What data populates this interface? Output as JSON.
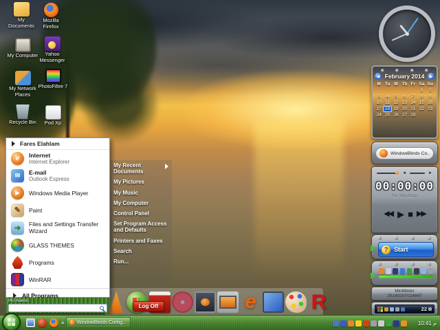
{
  "desktop": {
    "icons": [
      {
        "label": "My Documents",
        "icon": "folder-documents-icon"
      },
      {
        "label": "Mozilla Firefox",
        "icon": "firefox-icon"
      },
      {
        "label": "My Computer",
        "icon": "computer-icon"
      },
      {
        "label": "Yahoo Messenger",
        "icon": "yahoo-icon"
      },
      {
        "label": "My Network Places",
        "icon": "network-icon"
      },
      {
        "label": "PhotoFiltre 7",
        "icon": "photofiltre-icon"
      },
      {
        "label": "Recycle Bin",
        "icon": "recycle-icon"
      },
      {
        "label": "Pod Xp",
        "icon": "podxp-icon"
      }
    ]
  },
  "start_menu": {
    "user_name": "Fares Elahlam",
    "left_items": [
      {
        "title": "Internet",
        "subtitle": "Internet Explorer",
        "icon": "internet-explorer-icon",
        "glyph": "e"
      },
      {
        "title": "E-mail",
        "subtitle": "Outlook Express",
        "icon": "outlook-icon",
        "glyph": "✉"
      },
      {
        "title": "Windows Media Player",
        "subtitle": "",
        "icon": "wmp-icon",
        "glyph": "▶"
      },
      {
        "title": "Paint",
        "subtitle": "",
        "icon": "paint-icon",
        "glyph": "✎"
      },
      {
        "title": "Files and Settings Transfer Wizard",
        "subtitle": "",
        "icon": "transfer-icon",
        "glyph": "➔"
      },
      {
        "title": "GLASS THEMES",
        "subtitle": "",
        "icon": "glass-icon",
        "glyph": ""
      },
      {
        "title": "Programs",
        "subtitle": "",
        "icon": "programs-icon",
        "glyph": ""
      },
      {
        "title": "WinRAR",
        "subtitle": "",
        "icon": "winrar-icon",
        "glyph": ""
      }
    ],
    "all_programs_label": "All Programs",
    "footer_text": "HU Aueoc",
    "search_value": "",
    "right_items": [
      {
        "label": "My Recent Documents",
        "has_arrow": true
      },
      {
        "label": "My Pictures",
        "has_arrow": false
      },
      {
        "label": "My Music",
        "has_arrow": false
      },
      {
        "label": "My Computer",
        "has_arrow": false
      },
      {
        "label": "Control Panel",
        "has_arrow": false
      },
      {
        "label": "Set Program Access and Defaults",
        "has_arrow": false
      },
      {
        "label": "Printers and Faxes",
        "has_arrow": false
      },
      {
        "label": "Search",
        "has_arrow": false
      },
      {
        "label": "Run...",
        "has_arrow": false
      }
    ],
    "log_off_label": "Log Off"
  },
  "dock": {
    "icons": [
      {
        "name": "traffic-cone-icon"
      },
      {
        "name": "windows-orb-icon"
      },
      {
        "name": "red-box-icon"
      },
      {
        "name": "red-disc-icon"
      },
      {
        "name": "media-monitor-icon"
      },
      {
        "name": "display-monitor-icon"
      },
      {
        "name": "internet-explorer-icon",
        "glyph": "e"
      },
      {
        "name": "blue-screen-icon"
      },
      {
        "name": "paint-palette-icon"
      },
      {
        "name": "letter-r-icon",
        "glyph": "R"
      }
    ]
  },
  "taskbar": {
    "quick_launch": [
      {
        "name": "show-desktop-icon"
      },
      {
        "name": "red-app-icon"
      },
      {
        "name": "firefox-icon"
      }
    ],
    "overflow_chevron": "»",
    "window_button_label": "WindowBlinds Config...",
    "tray_icons": [
      {
        "name": "tray-computer-icon",
        "color": "#4a7ab8"
      },
      {
        "name": "tray-documents-icon",
        "color": "#3a5ad0"
      },
      {
        "name": "tray-windowblinds-icon",
        "color": "#e8862a"
      },
      {
        "name": "tray-yahoo-icon",
        "color": "#f8d020"
      },
      {
        "name": "tray-red-app-icon",
        "color": "#d84010"
      },
      {
        "name": "tray-monitor-icon",
        "color": "#9aa0a8"
      },
      {
        "name": "tray-volume-icon",
        "color": "#caced2"
      },
      {
        "name": "tray-green-app-icon",
        "color": "#3aa040"
      },
      {
        "name": "tray-dark-app-icon",
        "color": "#2a3a8a"
      },
      {
        "name": "tray-alert-icon",
        "color": "#e89020"
      }
    ],
    "clock": "10:41 م"
  },
  "sidebar": {
    "calendar": {
      "month_title": "February 2014",
      "day_headers": [
        "M",
        "Tu",
        "W",
        "Th",
        "Fr",
        "Sa",
        "Su"
      ],
      "cells": [
        "",
        "",
        "",
        "",
        "",
        "1",
        "2",
        "3",
        "4",
        "5",
        "6",
        "7",
        "8",
        "9",
        "10",
        "11",
        "12",
        "13",
        "14",
        "15",
        "16",
        "17",
        "18",
        "19",
        "20",
        "21",
        "22",
        "23",
        "24",
        "25",
        "26",
        "27",
        "28",
        "",
        ""
      ],
      "selected_day": "18",
      "prev_glyph": "◀",
      "next_glyph": "▶"
    },
    "windowblinds_button_label": "WindowBlinds Co..",
    "player": {
      "time_display": "00:00:00",
      "status": "No WinAmp",
      "prev_glyph": "◀◀",
      "play_glyph": "▶",
      "stop_glyph": "■",
      "next_glyph": "▶▶"
    },
    "start_widget": {
      "label": "Start",
      "orb_glyph": "?"
    },
    "launcher_icons": [
      {
        "name": "launch-orange-icon",
        "color": "#e8862a"
      },
      {
        "name": "launch-search-icon",
        "color": "#c8ccd2"
      },
      {
        "name": "launch-darkblue-icon",
        "color": "#2a3a8a"
      },
      {
        "name": "launch-blue-icon",
        "color": "#3a7ad8"
      },
      {
        "name": "launch-green-icon",
        "color": "#3aa040"
      },
      {
        "name": "launch-dark-icon",
        "color": "#3a4048"
      },
      {
        "name": "launch-lightblue-icon",
        "color": "#8ab4e8"
      },
      {
        "name": "launch-gray-icon",
        "color": "#9aa0a8"
      }
    ],
    "minimeter": {
      "title": "MiniMeter",
      "value": "20140207024847"
    },
    "meter": {
      "value": "22"
    }
  }
}
